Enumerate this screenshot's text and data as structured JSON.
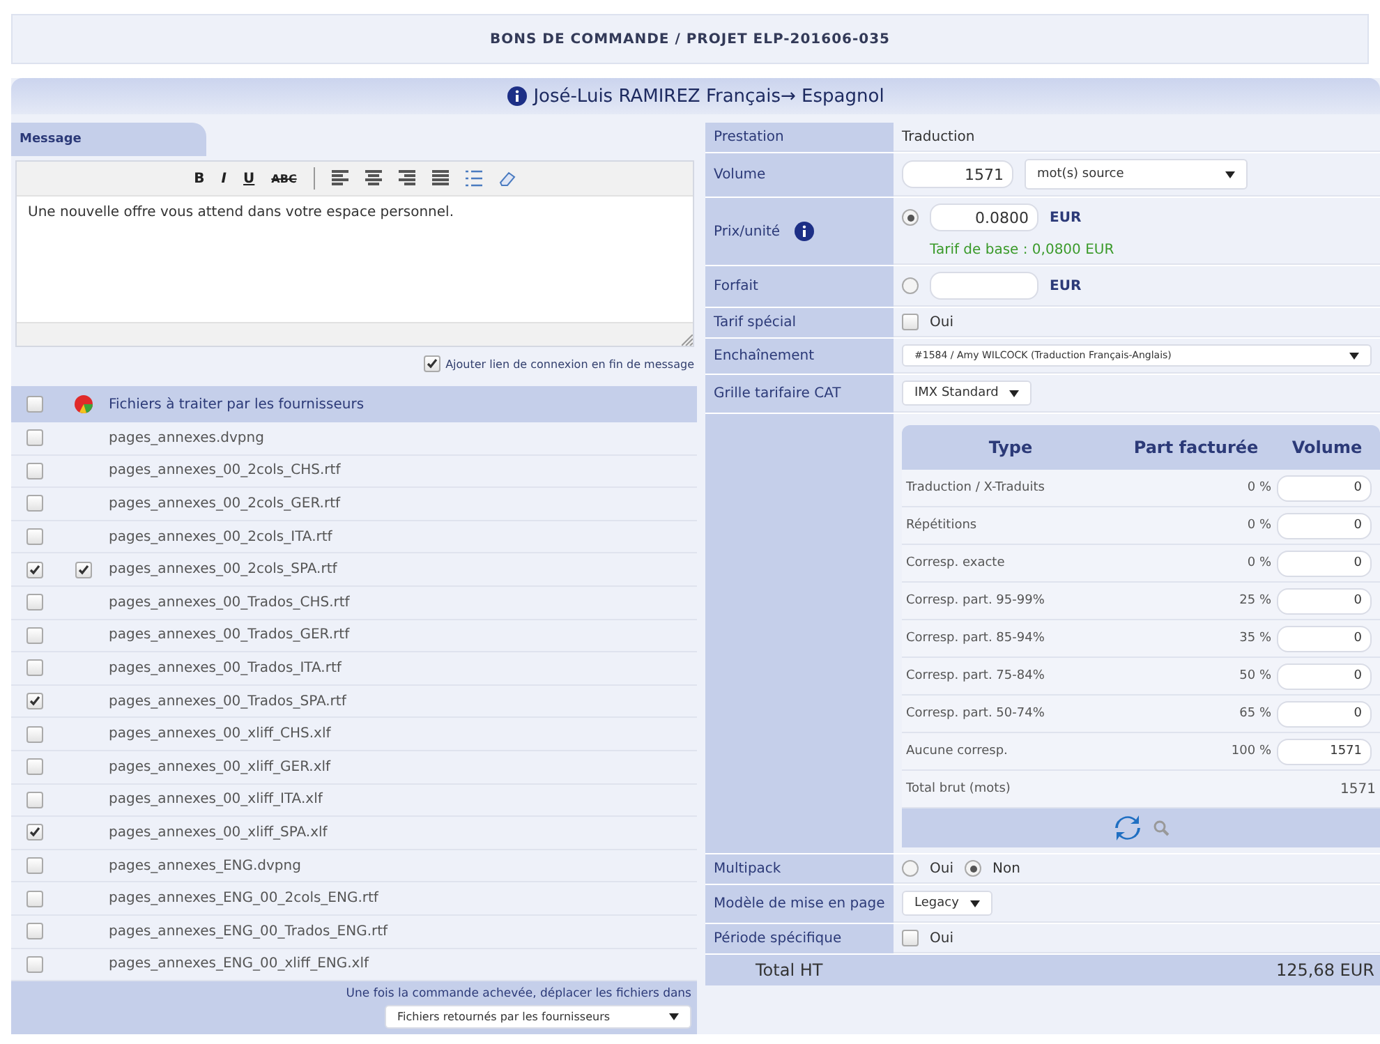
{
  "title": "BONS DE COMMANDE / PROJET ELP-201606-035",
  "header": "José-Luis RAMIREZ Français→ Espagnol",
  "message": {
    "tab": "Message",
    "toolbar": [
      "B",
      "I",
      "U",
      "ABC"
    ],
    "text": "Une nouvelle offre vous attend dans votre espace personnel.",
    "add_link": {
      "label": "Ajouter lien de connexion en fin de message",
      "checked": true
    }
  },
  "files": {
    "header_checked": false,
    "heading": "Fichiers à traiter par les fournisseurs",
    "rows": [
      {
        "name": "pages_annexes.dvpng",
        "checked": false,
        "returned": false
      },
      {
        "name": "pages_annexes_00_2cols_CHS.rtf",
        "checked": false,
        "returned": false
      },
      {
        "name": "pages_annexes_00_2cols_GER.rtf",
        "checked": false,
        "returned": false
      },
      {
        "name": "pages_annexes_00_2cols_ITA.rtf",
        "checked": false,
        "returned": false
      },
      {
        "name": "pages_annexes_00_2cols_SPA.rtf",
        "checked": true,
        "returned": true
      },
      {
        "name": "pages_annexes_00_Trados_CHS.rtf",
        "checked": false,
        "returned": false
      },
      {
        "name": "pages_annexes_00_Trados_GER.rtf",
        "checked": false,
        "returned": false
      },
      {
        "name": "pages_annexes_00_Trados_ITA.rtf",
        "checked": false,
        "returned": false
      },
      {
        "name": "pages_annexes_00_Trados_SPA.rtf",
        "checked": true,
        "returned": false
      },
      {
        "name": "pages_annexes_00_xliff_CHS.xlf",
        "checked": false,
        "returned": false
      },
      {
        "name": "pages_annexes_00_xliff_GER.xlf",
        "checked": false,
        "returned": false
      },
      {
        "name": "pages_annexes_00_xliff_ITA.xlf",
        "checked": false,
        "returned": false
      },
      {
        "name": "pages_annexes_00_xliff_SPA.xlf",
        "checked": true,
        "returned": false
      },
      {
        "name": "pages_annexes_ENG.dvpng",
        "checked": false,
        "returned": false
      },
      {
        "name": "pages_annexes_ENG_00_2cols_ENG.rtf",
        "checked": false,
        "returned": false
      },
      {
        "name": "pages_annexes_ENG_00_Trados_ENG.rtf",
        "checked": false,
        "returned": false
      },
      {
        "name": "pages_annexes_ENG_00_xliff_ENG.xlf",
        "checked": false,
        "returned": false
      }
    ],
    "footer_text": "Une fois la commande achevée, déplacer les fichiers dans",
    "destination": "Fichiers retournés par les fournisseurs"
  },
  "fields": [
    {
      "kind": "text",
      "label": "Prestation",
      "value": "Traduction"
    },
    {
      "kind": "volume",
      "label": "Volume",
      "value": "1571",
      "unit": "mot(s) source"
    },
    {
      "kind": "price",
      "label": "Prix/unité",
      "selected": true,
      "value": "0.0800",
      "currency": "EUR",
      "note": "Tarif de base : 0,0800 EUR"
    },
    {
      "kind": "price",
      "label": "Forfait",
      "selected": false,
      "currency": "EUR"
    },
    {
      "kind": "check",
      "label": "Tarif spécial",
      "option": "Oui",
      "checked": false
    },
    {
      "kind": "select",
      "label": "Enchaînement",
      "value": "#1584 / Amy WILCOCK (Traduction Français-Anglais)",
      "wide": true
    },
    {
      "kind": "select",
      "label": "Grille tarifaire CAT",
      "value": "IMX Standard",
      "wide": false
    },
    {
      "kind": "table",
      "columns": [
        "Type",
        "Part facturée",
        "Volume"
      ],
      "rows": [
        {
          "type": "Traduction / X-Traduits",
          "part": "0 %",
          "volume": "0"
        },
        {
          "type": "Répétitions",
          "part": "0 %",
          "volume": "0"
        },
        {
          "type": "Corresp. exacte",
          "part": "0 %",
          "volume": "0"
        },
        {
          "type": "Corresp. part. 95-99%",
          "part": "25 %",
          "volume": "0"
        },
        {
          "type": "Corresp. part. 85-94%",
          "part": "35 %",
          "volume": "0"
        },
        {
          "type": "Corresp. part. 75-84%",
          "part": "50 %",
          "volume": "0"
        },
        {
          "type": "Corresp. part. 50-74%",
          "part": "65 %",
          "volume": "0"
        },
        {
          "type": "Aucune corresp.",
          "part": "100 %",
          "volume": "1571"
        }
      ],
      "total_label": "Total brut (mots)",
      "total": "1571"
    },
    {
      "kind": "radios",
      "label": "Multipack",
      "options": [
        {
          "label": "Oui",
          "selected": false
        },
        {
          "label": "Non",
          "selected": true
        }
      ]
    },
    {
      "kind": "select",
      "label": "Modèle de mise en page",
      "value": "Legacy",
      "wide": false
    },
    {
      "kind": "check",
      "label": "Période spécifique",
      "option": "Oui",
      "checked": false
    }
  ],
  "total": {
    "label": "Total HT",
    "value": "125,68 EUR"
  }
}
